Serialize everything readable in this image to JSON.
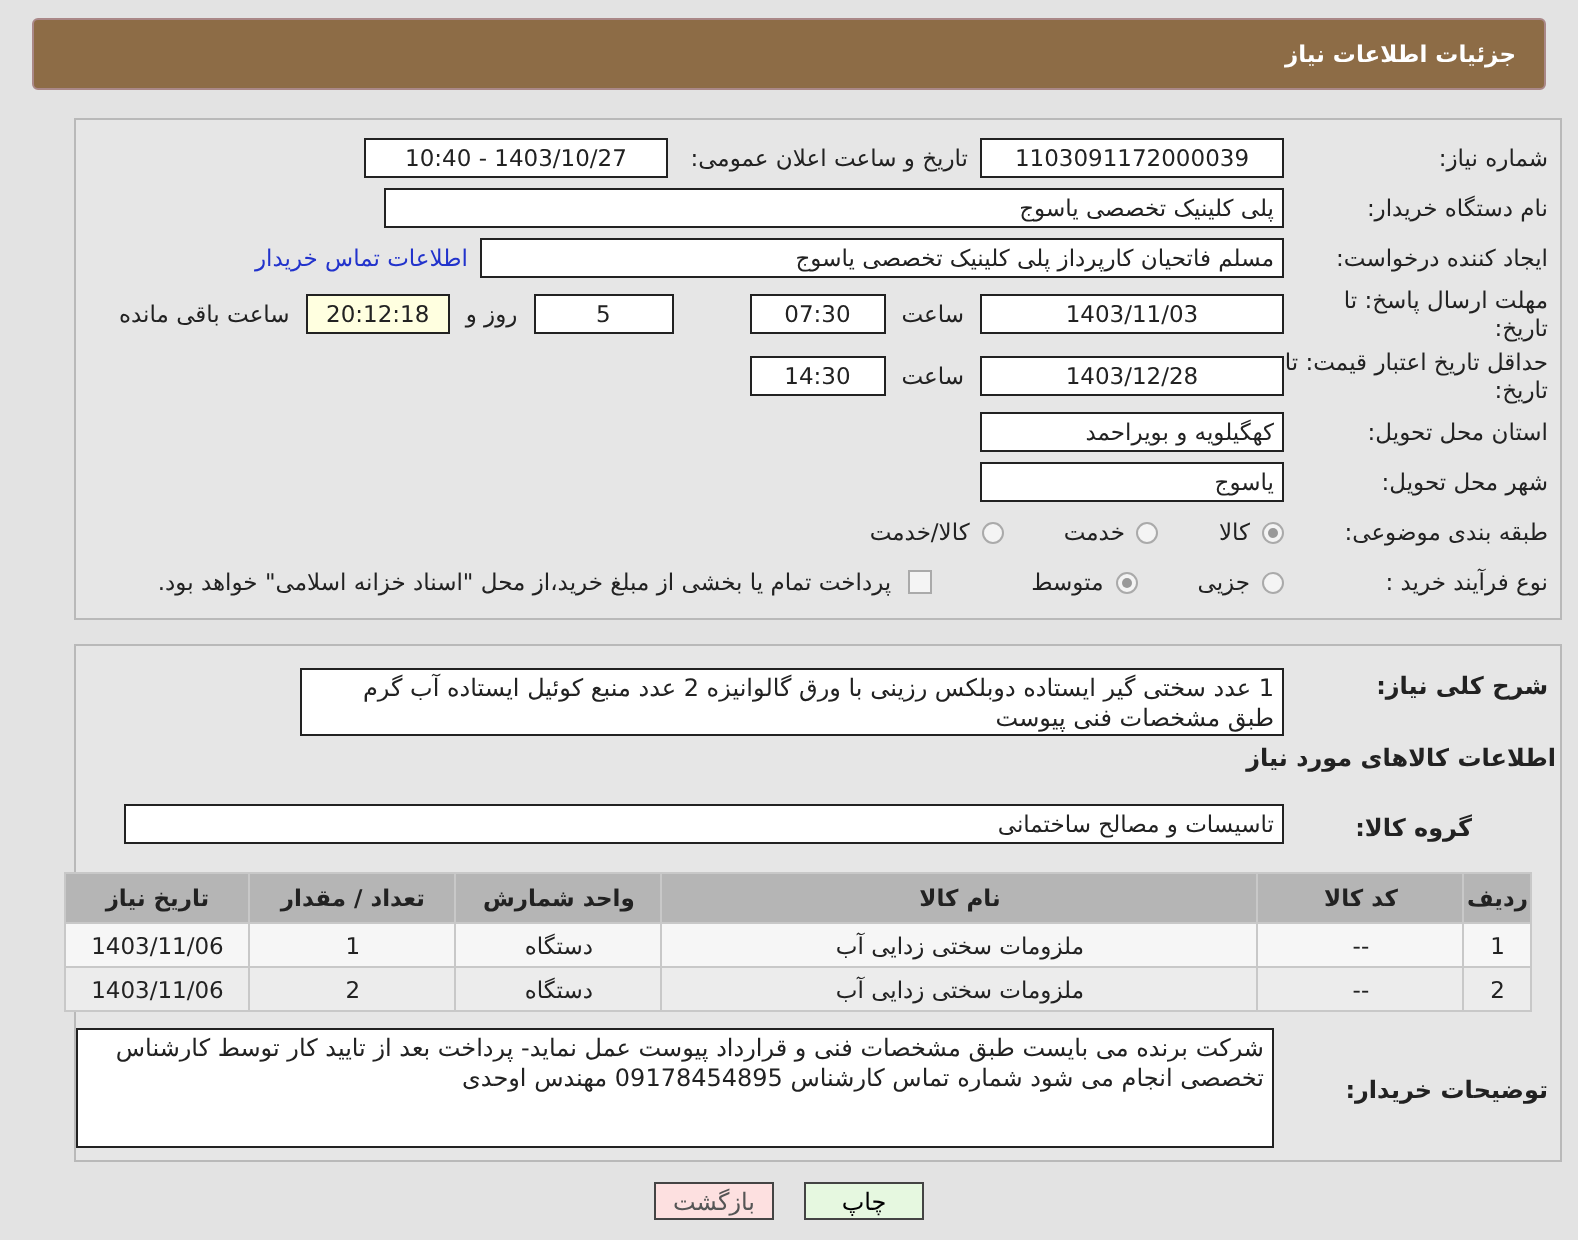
{
  "header": {
    "title": "جزئیات اطلاعات نیاز"
  },
  "need_number": {
    "label": "شماره نیاز:",
    "value": "1103091172000039"
  },
  "announce": {
    "label": "تاریخ و ساعت اعلان عمومی:",
    "value": "1403/10/27 - 10:40"
  },
  "buyer_org": {
    "label": "نام دستگاه خریدار:",
    "value": "پلی کلینیک تخصصی یاسوج"
  },
  "requester": {
    "label": "ایجاد کننده درخواست:",
    "value": "مسلم فاتحیان کارپرداز  پلی کلینیک تخصصی یاسوج",
    "link": "اطلاعات تماس خریدار"
  },
  "reply_deadline": {
    "label": "مهلت ارسال پاسخ: تا تاریخ:",
    "date": "1403/11/03",
    "time_label": "ساعت",
    "time": "07:30",
    "days": "5",
    "days_label": "روز و",
    "remaining": "20:12:18",
    "remaining_label": "ساعت باقی مانده"
  },
  "price_validity": {
    "label": "حداقل تاریخ اعتبار قیمت: تا تاریخ:",
    "date": "1403/12/28",
    "time_label": "ساعت",
    "time": "14:30"
  },
  "province": {
    "label": "استان محل تحویل:",
    "value": "کهگیلویه و بویراحمد"
  },
  "city": {
    "label": "شهر محل تحویل:",
    "value": "یاسوج"
  },
  "category": {
    "label": "طبقه بندی موضوعی:",
    "options": [
      {
        "label": "کالا",
        "selected": true
      },
      {
        "label": "خدمت",
        "selected": false
      },
      {
        "label": "کالا/خدمت",
        "selected": false
      }
    ]
  },
  "process": {
    "label": "نوع فرآیند خرید :",
    "options": [
      {
        "label": "جزیی",
        "selected": false
      },
      {
        "label": "متوسط",
        "selected": true
      }
    ],
    "payment": {
      "checked": false,
      "text": "پرداخت تمام یا بخشی از مبلغ خرید،از محل \"اسناد خزانه اسلامی\" خواهد بود."
    }
  },
  "description": {
    "label": "شرح کلی نیاز:",
    "value": "1 عدد سختی گیر ایستاده دوبلکس رزینی با ورق گالوانیزه 2 عدد منبع کوئیل ایستاده آب گرم  طبق مشخصات فنی پیوست"
  },
  "goods_heading": "اطلاعات کالاهای مورد نیاز",
  "goods_group": {
    "label": "گروه کالا:",
    "value": "تاسیسات و مصالح ساختمانی"
  },
  "table": {
    "columns": [
      "ردیف",
      "کد کالا",
      "نام کالا",
      "واحد شمارش",
      "تعداد / مقدار",
      "تاریخ نیاز"
    ],
    "rows": [
      [
        "1",
        "--",
        "ملزومات سختی زدایی آب",
        "دستگاه",
        "1",
        "1403/11/06"
      ],
      [
        "2",
        "--",
        "ملزومات سختی زدایی آب",
        "دستگاه",
        "2",
        "1403/11/06"
      ]
    ]
  },
  "buyer_notes": {
    "label": "توضیحات خریدار:",
    "value": "شرکت برنده می بایست طبق مشخصات فنی و قرارداد پیوست عمل نماید- پرداخت بعد از تایید کار توسط کارشناس تخصصی انجام می شود  شماره تماس کارشناس 09178454895 مهندس اوحدی"
  },
  "buttons": [
    {
      "label": "چاپ",
      "kind": "print"
    },
    {
      "label": "بازگشت",
      "kind": "back"
    }
  ]
}
